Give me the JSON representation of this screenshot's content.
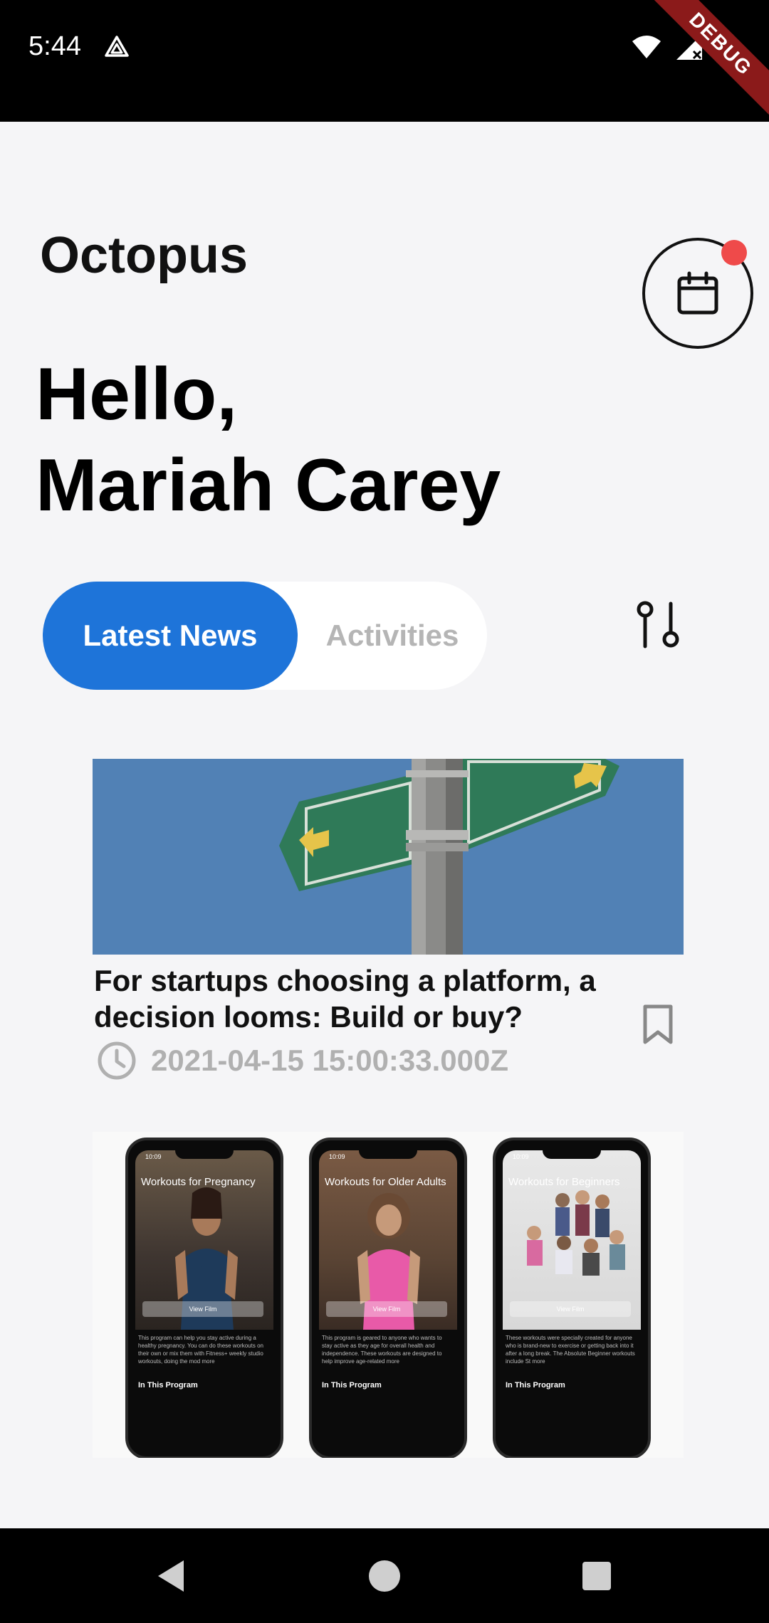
{
  "status_bar": {
    "time": "5:44",
    "debug_label": "DEBUG"
  },
  "header": {
    "app_name": "Octopus",
    "greeting_line1": "Hello,",
    "greeting_line2": "Mariah Carey"
  },
  "tabs": [
    {
      "label": "Latest News",
      "active": true
    },
    {
      "label": "Activities",
      "active": false
    }
  ],
  "news": [
    {
      "title": "For startups choosing a platform, a decision looms: Build or buy?",
      "date": "2021-04-15 15:00:33.000Z",
      "image": "street-sign-arrows"
    },
    {
      "image": "fitness-app-phones",
      "phones": [
        {
          "time": "10:09",
          "title": "Workouts for Pregnancy",
          "view": "View Film",
          "section": "In This Program",
          "body": "This program can help you stay active during a healthy pregnancy. You can do these workouts on their own or mix them with Fitness+ weekly studio workouts, doing the mod more"
        },
        {
          "time": "10:09",
          "title": "Workouts for Older Adults",
          "view": "View Film",
          "section": "In This Program",
          "body": "This program is geared to anyone who wants to stay active as they age for overall health and independence. These workouts are designed to help improve age-related more"
        },
        {
          "time": "10:09",
          "title": "Workouts for Beginners",
          "view": "View Film",
          "section": "In This Program",
          "body": "These workouts were specially created for anyone who is brand-new to exercise or getting back into it after a long break. The Absolute Beginner workouts include St more"
        }
      ]
    }
  ],
  "colors": {
    "accent": "#1e74d9",
    "notification": "#ef4a4a",
    "background": "#f5f5f7"
  }
}
